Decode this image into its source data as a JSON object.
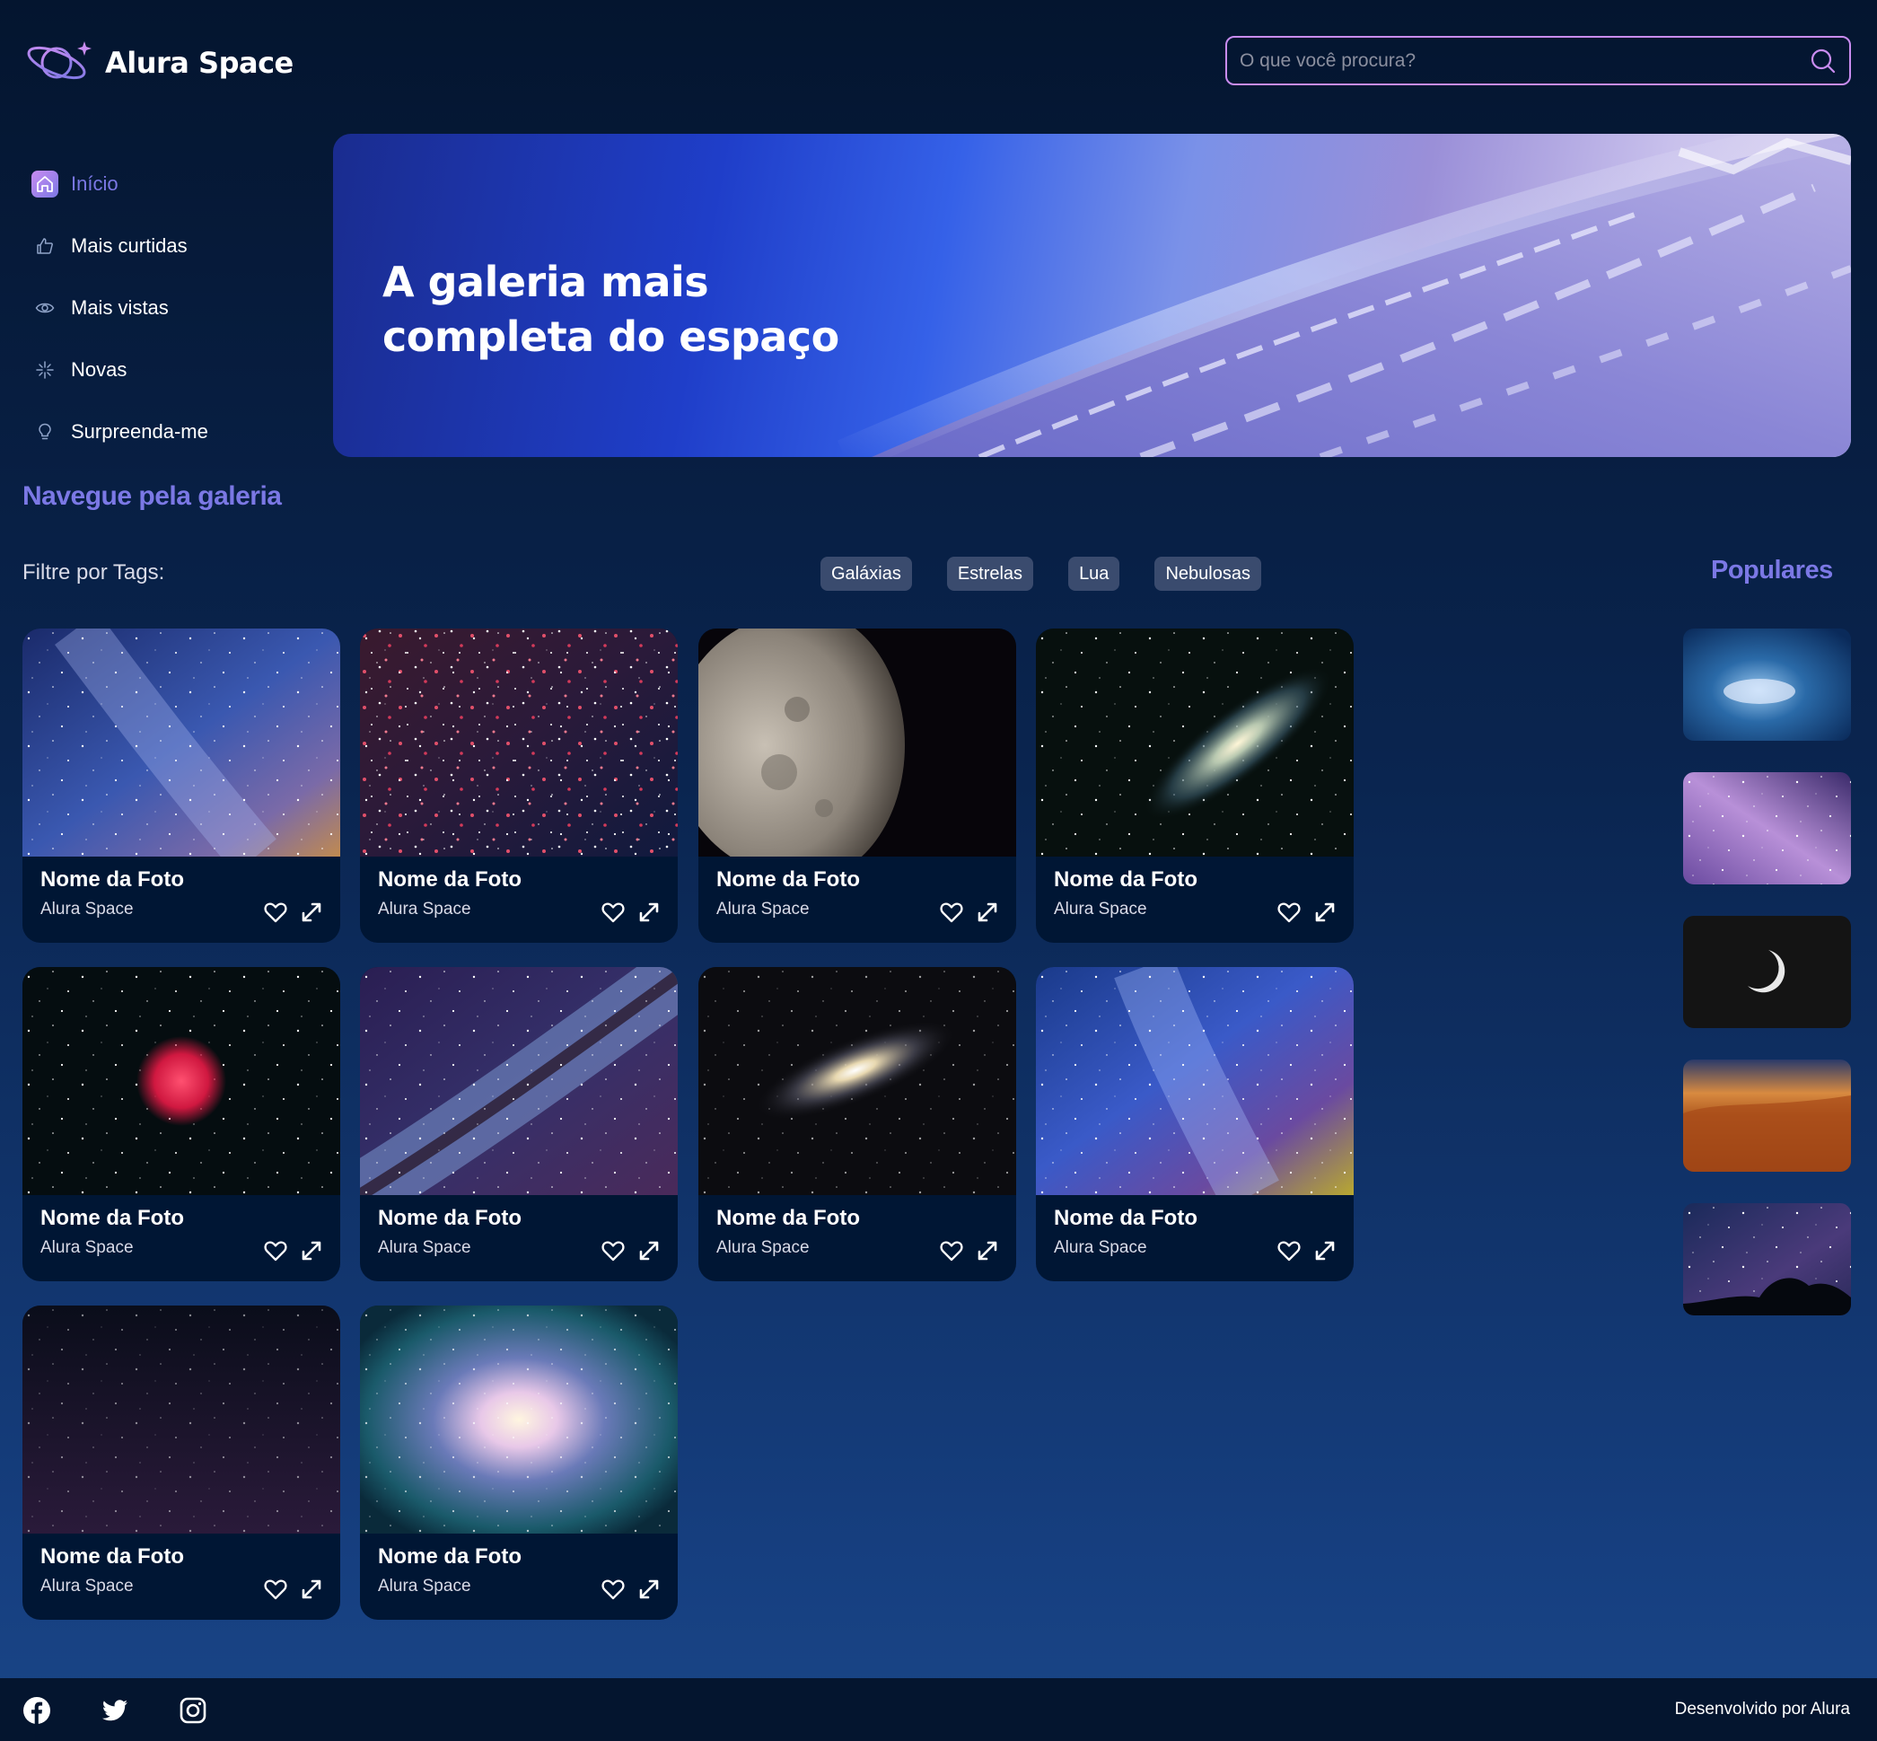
{
  "app": {
    "logo_text": "Alura Space",
    "search_placeholder": "O que você procura?"
  },
  "sidebar": {
    "items": [
      {
        "label": "Início",
        "icon": "home-icon",
        "active": true
      },
      {
        "label": "Mais curtidas",
        "icon": "thumbs-up-icon"
      },
      {
        "label": "Mais vistas",
        "icon": "eye-icon"
      },
      {
        "label": "Novas",
        "icon": "sparkle-icon"
      },
      {
        "label": "Surpreenda-me",
        "icon": "lightbulb-icon"
      }
    ]
  },
  "banner": {
    "title": "A galeria mais completa do espaço"
  },
  "gallery": {
    "section_title": "Navegue pela galeria",
    "filter_label": "Filtre por Tags:",
    "tags": [
      "Galáxias",
      "Estrelas",
      "Lua",
      "Nebulosas"
    ],
    "populares_title": "Populares",
    "cards": [
      {
        "name": "Nome da Foto",
        "author": "Alura Space",
        "image": "milky-way-blue"
      },
      {
        "name": "Nome da Foto",
        "author": "Alura Space",
        "image": "red-star-field"
      },
      {
        "name": "Nome da Foto",
        "author": "Alura Space",
        "image": "half-moon"
      },
      {
        "name": "Nome da Foto",
        "author": "Alura Space",
        "image": "andromeda-galaxy"
      },
      {
        "name": "Nome da Foto",
        "author": "Alura Space",
        "image": "rosette-nebula"
      },
      {
        "name": "Nome da Foto",
        "author": "Alura Space",
        "image": "milky-way-band"
      },
      {
        "name": "Nome da Foto",
        "author": "Alura Space",
        "image": "spiral-galaxy"
      },
      {
        "name": "Nome da Foto",
        "author": "Alura Space",
        "image": "milky-way-colorful"
      },
      {
        "name": "Nome da Foto",
        "author": "Alura Space",
        "image": "dark-starfield"
      },
      {
        "name": "Nome da Foto",
        "author": "Alura Space",
        "image": "bright-cluster"
      }
    ],
    "popular": [
      "blue-cloud",
      "purple-milky-way",
      "crescent-moon",
      "desert-dunes",
      "night-sky-trees"
    ]
  },
  "footer": {
    "credit": "Desenvolvido por Alura",
    "social": [
      "facebook-icon",
      "twitter-icon",
      "instagram-icon"
    ]
  },
  "colors": {
    "accent": "#7b78e5",
    "accent_light": "#c98cf1",
    "card_bg": "#001634",
    "tag_bg": "#3a4b6e",
    "footer_bg": "#04152f"
  }
}
